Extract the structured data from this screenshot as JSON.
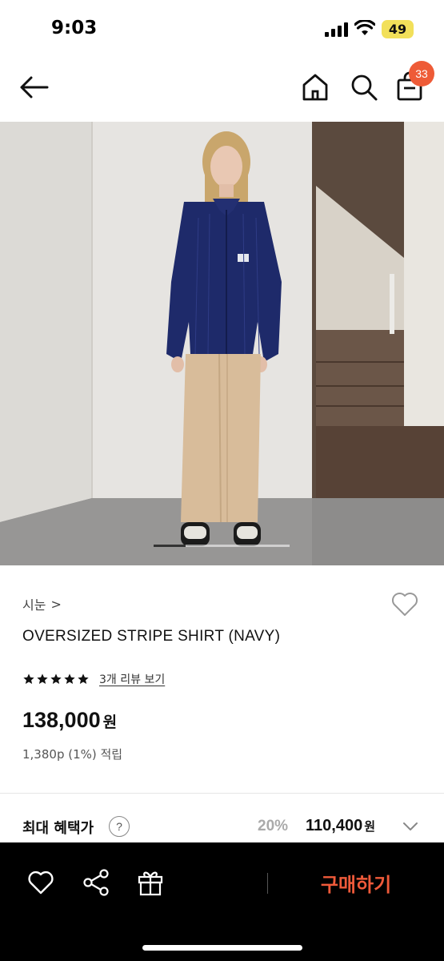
{
  "status_bar": {
    "time": "9:03",
    "battery": "49",
    "icons": [
      "signal-icon",
      "wifi-icon",
      "battery-icon"
    ]
  },
  "header": {
    "icons": [
      "back-arrow-icon",
      "home-icon",
      "search-icon",
      "shopping-bag-icon"
    ],
    "cart_count": "33",
    "badge_color": "#ee5b37"
  },
  "product": {
    "brand": "시눈",
    "brand_chevron": ">",
    "title": "OVERSIZED STRIPE SHIRT (NAVY)",
    "rating_stars": 5,
    "review_link": "3개 리뷰 보기",
    "price": "138,000",
    "price_unit": "원",
    "points": "1,380p (1%) 적립",
    "image_position": 1,
    "image_description_icon": "product-photo"
  },
  "benefit": {
    "label": "최대 혜택가",
    "help": "?",
    "rate": "20%",
    "price": "110,400",
    "price_unit": "원"
  },
  "bottom_bar": {
    "icons": [
      "heart-icon",
      "share-icon",
      "gift-icon"
    ],
    "buy_label": "구매하기",
    "buy_color": "#ef5a3a"
  }
}
